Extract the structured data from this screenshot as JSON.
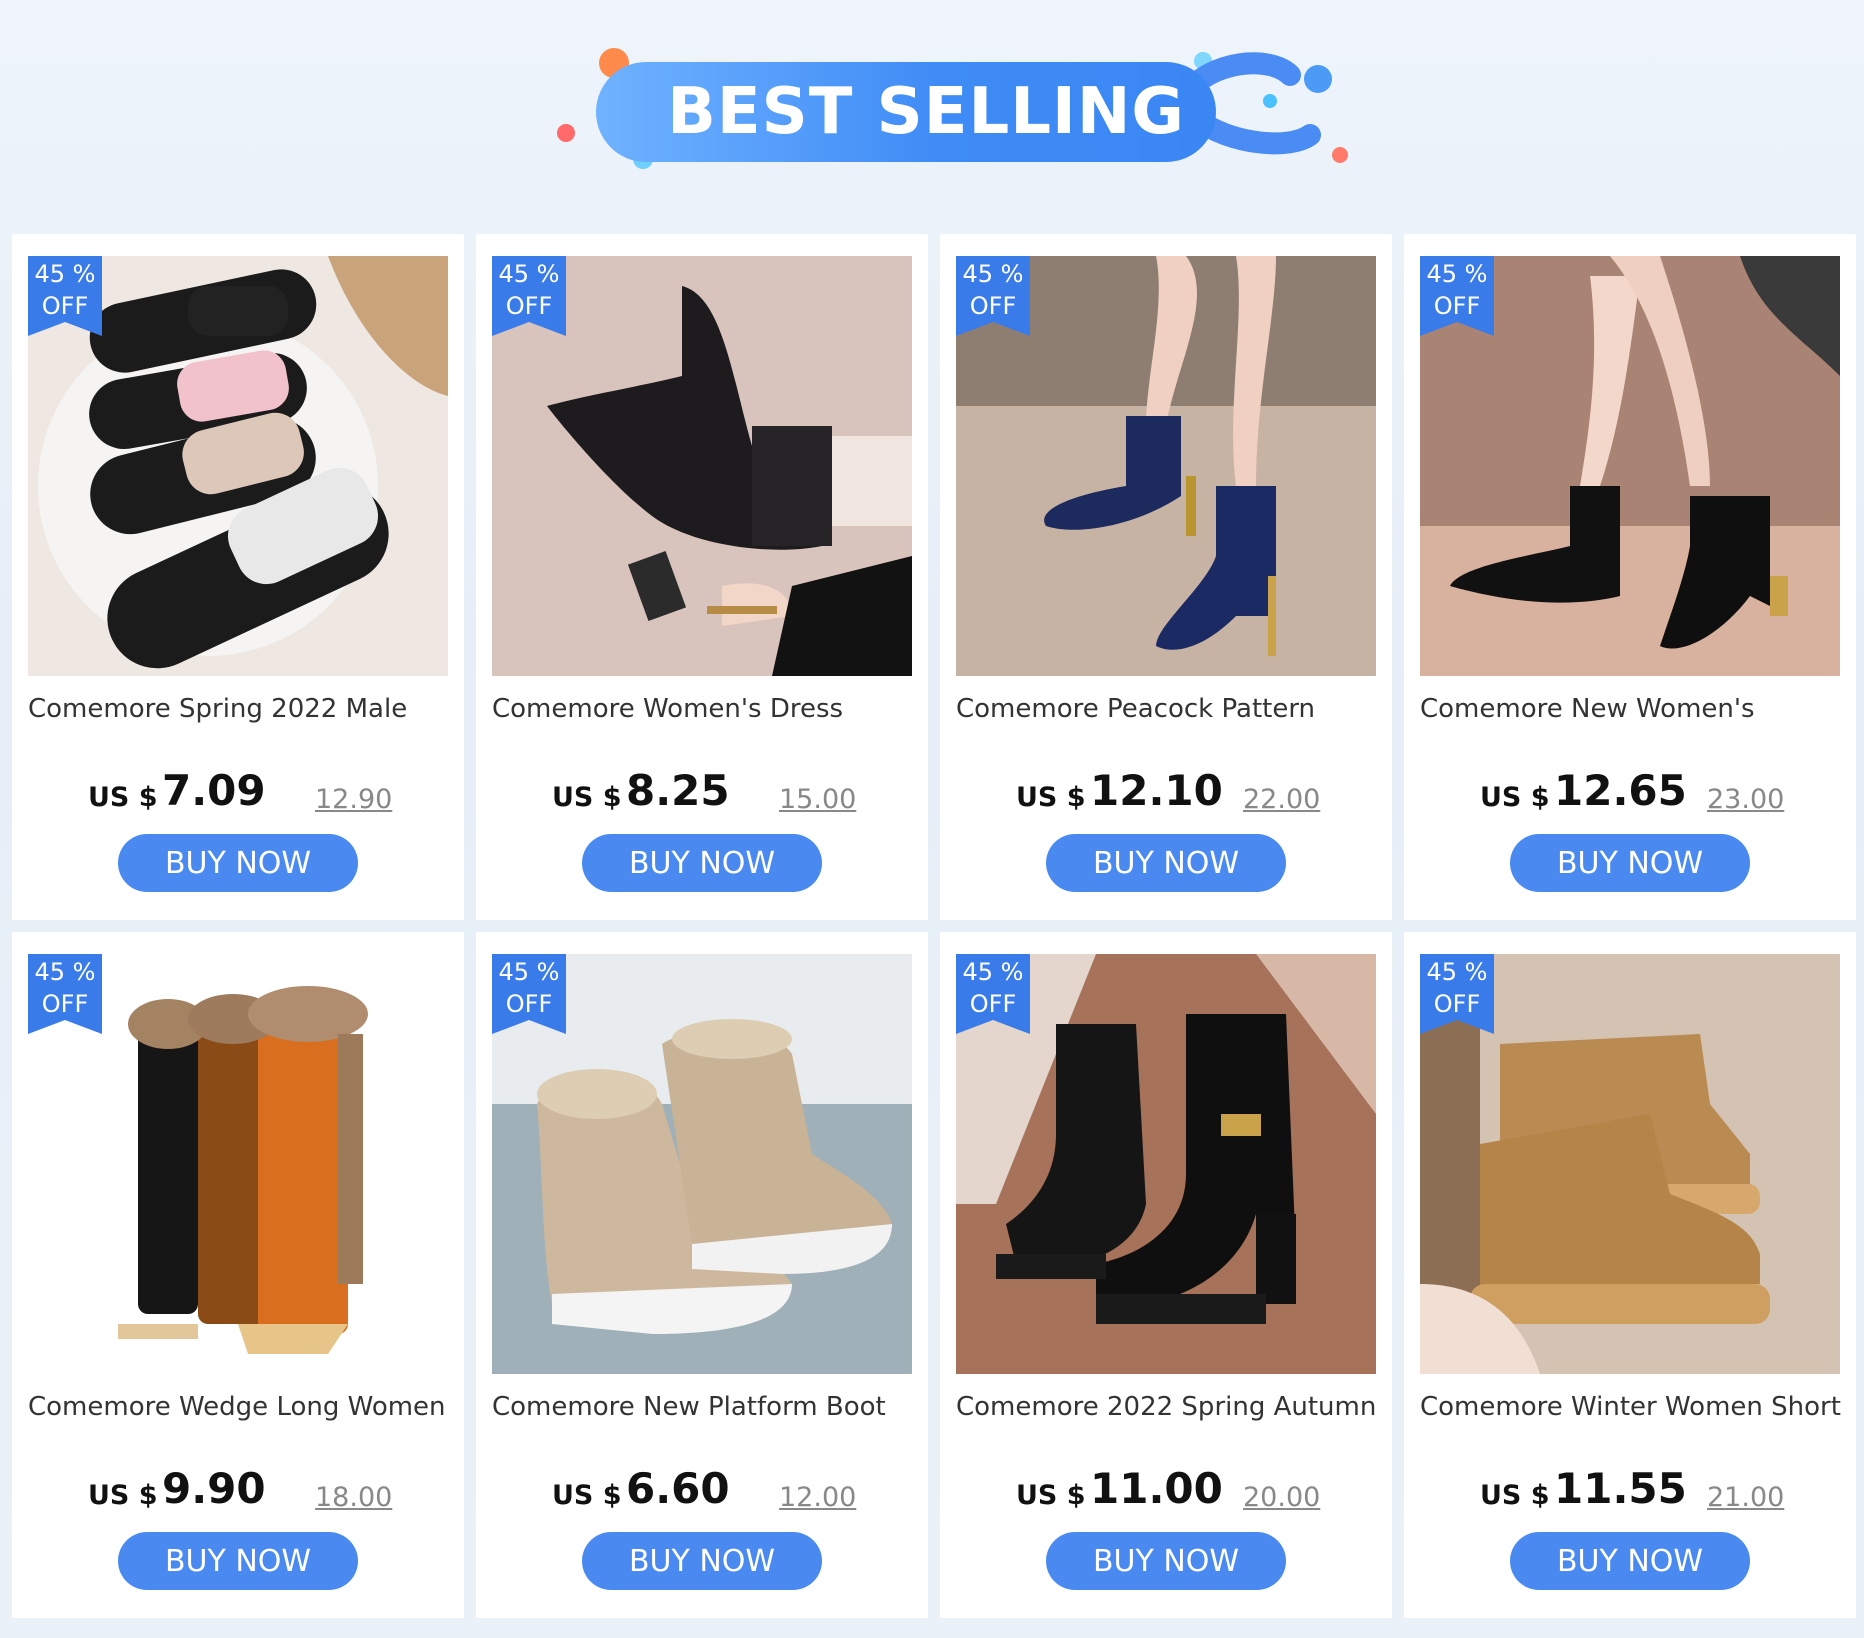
{
  "header": {
    "title": "BEST SELLING"
  },
  "colors": {
    "accent": "#4a8af0",
    "badge": "#3a7bea",
    "banner": "#3f8cf6"
  },
  "products": [
    {
      "badge_top": "45 %",
      "badge_bottom": "OFF",
      "title": "Comemore Spring 2022 Male",
      "currency": "US $",
      "price": "7.09",
      "old_price": "12.90",
      "button": "BUY NOW",
      "image": "black-slippers-image"
    },
    {
      "badge_top": "45 %",
      "badge_bottom": "OFF",
      "title": "Comemore Women's Dress",
      "currency": "US $",
      "price": "8.25",
      "old_price": "15.00",
      "button": "BUY NOW",
      "image": "black-sock-boot-image"
    },
    {
      "badge_top": "45 %",
      "badge_bottom": "OFF",
      "title": "Comemore Peacock Pattern",
      "currency": "US $",
      "price": "12.10",
      "old_price": "22.00",
      "button": "BUY NOW",
      "image": "blue-heel-boot-image"
    },
    {
      "badge_top": "45 %",
      "badge_bottom": "OFF",
      "title": "Comemore New Women's",
      "currency": "US $",
      "price": "12.65",
      "old_price": "23.00",
      "button": "BUY NOW",
      "image": "black-ankle-boot-image"
    },
    {
      "badge_top": "45 %",
      "badge_bottom": "OFF",
      "title": "Comemore Wedge Long Women",
      "currency": "US $",
      "price": "9.90",
      "old_price": "18.00",
      "button": "BUY NOW",
      "image": "fur-long-boots-image"
    },
    {
      "badge_top": "45 %",
      "badge_bottom": "OFF",
      "title": "Comemore New Platform Boot",
      "currency": "US $",
      "price": "6.60",
      "old_price": "12.00",
      "button": "BUY NOW",
      "image": "beige-sneaker-boot-image"
    },
    {
      "badge_top": "45 %",
      "badge_bottom": "OFF",
      "title": "Comemore 2022 Spring Autumn",
      "currency": "US $",
      "price": "11.00",
      "old_price": "20.00",
      "button": "BUY NOW",
      "image": "black-platform-boot-image"
    },
    {
      "badge_top": "45 %",
      "badge_bottom": "OFF",
      "title": "Comemore Winter Women Short",
      "currency": "US $",
      "price": "11.55",
      "old_price": "21.00",
      "button": "BUY NOW",
      "image": "tan-snow-boot-image"
    }
  ]
}
